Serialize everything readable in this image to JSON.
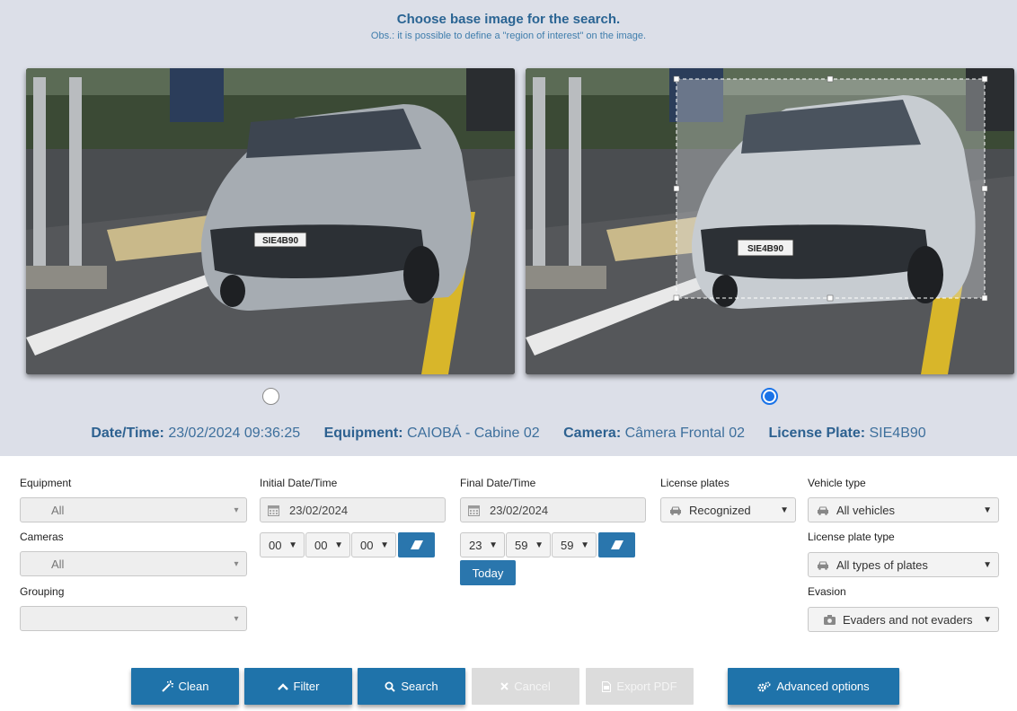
{
  "header": {
    "title": "Choose base image for the search.",
    "subtitle": "Obs.: it is possible to define a \"region of interest\" on the image."
  },
  "plate_text": "SIE4B90",
  "selected_image": 2,
  "meta": {
    "datetime_label": "Date/Time:",
    "datetime_value": "23/02/2024 09:36:25",
    "equipment_label": "Equipment:",
    "equipment_value": "CAIOBÁ - Cabine 02",
    "camera_label": "Camera:",
    "camera_value": "Câmera Frontal 02",
    "plate_label": "License Plate:",
    "plate_value": "SIE4B90"
  },
  "filters": {
    "equipment_label": "Equipment",
    "equipment_value": "All",
    "cameras_label": "Cameras",
    "cameras_value": "All",
    "grouping_label": "Grouping",
    "grouping_value": "",
    "initial_label": "Initial Date/Time",
    "initial_date": "23/02/2024",
    "initial_h": "00",
    "initial_m": "00",
    "initial_s": "00",
    "final_label": "Final Date/Time",
    "final_date": "23/02/2024",
    "final_h": "23",
    "final_m": "59",
    "final_s": "59",
    "today_label": "Today",
    "plates_label": "License plates",
    "plates_value": "Recognized",
    "vehicle_type_label": "Vehicle type",
    "vehicle_type_value": "All vehicles",
    "plate_type_label": "License plate type",
    "plate_type_value": "All types of plates",
    "evasion_label": "Evasion",
    "evasion_value": "Evaders and not evaders"
  },
  "actions": {
    "clean": "Clean",
    "filter": "Filter",
    "search": "Search",
    "cancel": "Cancel",
    "export": "Export PDF",
    "advanced": "Advanced options"
  },
  "colors": {
    "primary_button": "#1f73aa",
    "panel_bg": "#dcdfe8",
    "title_text": "#2a6493",
    "radio_selected": "#1a73e8"
  }
}
